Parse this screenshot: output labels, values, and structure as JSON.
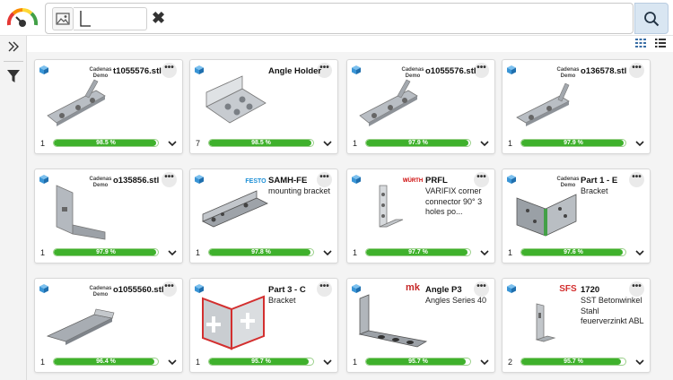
{
  "search": {
    "sketch_glyph": "L",
    "clear_glyph": "✖"
  },
  "icons": {
    "gauge": "speedometer-icon",
    "image_search": "image-icon",
    "search": "search-icon",
    "sidebar_toggle": "double-chevron-right-icon",
    "filter": "filter-icon",
    "grid_view": "grid-view-icon",
    "list_view": "list-view-icon",
    "card_part": "cube-icon",
    "card_menu": "more-icon",
    "card_expand": "chevron-down-icon"
  },
  "colors": {
    "progress": "#3fb12c",
    "search_button": "#d9e6f2",
    "cube": "#3a95d6"
  },
  "cards": [
    {
      "title": "t1055576.stl",
      "desc": "",
      "logo": "Cadenas Demo",
      "count": "1",
      "percent": "98.5 %",
      "fill": 0.985,
      "thumb": "plate"
    },
    {
      "title": "Angle Holder",
      "desc": "",
      "logo": "",
      "count": "7",
      "percent": "98.5 %",
      "fill": 0.985,
      "thumb": "holder"
    },
    {
      "title": "o1055576.stl",
      "desc": "",
      "logo": "Cadenas Demo",
      "count": "1",
      "percent": "97.9 %",
      "fill": 0.979,
      "thumb": "plate"
    },
    {
      "title": "o136578.stl",
      "desc": "",
      "logo": "Cadenas Demo",
      "count": "1",
      "percent": "97.9 %",
      "fill": 0.979,
      "thumb": "plate2"
    },
    {
      "title": "o135856.stl",
      "desc": "",
      "logo": "Cadenas Demo",
      "count": "1",
      "percent": "97.9 %",
      "fill": 0.979,
      "thumb": "tall"
    },
    {
      "title": "SAMH-FE",
      "desc": "mounting bracket",
      "logo": "FESTO",
      "count": "1",
      "percent": "97.8 %",
      "fill": 0.978,
      "thumb": "bracket"
    },
    {
      "title": "PRFL",
      "desc": "VARIFIX corner connector 90° 3 holes po...",
      "logo": "WÜRTH",
      "count": "1",
      "percent": "97.7 %",
      "fill": 0.977,
      "thumb": "prfl"
    },
    {
      "title": "Part 1 - E",
      "desc": "Bracket",
      "logo": "Cadenas Demo",
      "count": "1",
      "percent": "97.6 %",
      "fill": 0.976,
      "thumb": "corner"
    },
    {
      "title": "o1055560.stl",
      "desc": "",
      "logo": "Cadenas Demo",
      "count": "1",
      "percent": "96.4 %",
      "fill": 0.964,
      "thumb": "flat"
    },
    {
      "title": "Part 3 - C",
      "desc": "Bracket",
      "logo": "",
      "count": "1",
      "percent": "95.7 %",
      "fill": 0.957,
      "thumb": "redcorner"
    },
    {
      "title": "Angle P3",
      "desc": "Angles Series 40",
      "logo": "mk",
      "count": "1",
      "percent": "95.7 %",
      "fill": 0.957,
      "thumb": "anglep3"
    },
    {
      "title": "1720",
      "desc": "SST Betonwinkel Stahl feuerverzinkt ABL",
      "logo": "SFS",
      "count": "2",
      "percent": "95.7 %",
      "fill": 0.957,
      "thumb": "small"
    }
  ]
}
